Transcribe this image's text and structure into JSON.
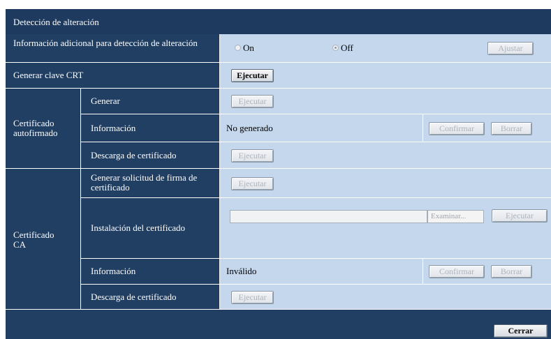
{
  "section_title": "Detección de alteración",
  "tamper": {
    "label": "Información adicional para detección de alteración",
    "on_label": "On",
    "off_label": "Off",
    "selected": "Off",
    "set_button": "Ajustar"
  },
  "crt_key": {
    "label": "Generar clave CRT",
    "execute_button": "Ejecutar"
  },
  "self_signed": {
    "group_label": "Certificado autofirmado",
    "generate_label": "Generar",
    "generate_button": "Ejecutar",
    "info_label": "Información",
    "info_status": "No generado",
    "confirm_button": "Confirmar",
    "delete_button": "Borrar",
    "download_label": "Descarga de certificado",
    "download_button": "Ejecutar"
  },
  "ca": {
    "group_label": "Certificado CA",
    "csr_label": "Generar solicitud de firma de certificado",
    "csr_button": "Ejecutar",
    "install_label": "Instalación del certificado",
    "browse_button": "Examinar...",
    "install_button": "Ejecutar",
    "file_value": "",
    "info_label": "Información",
    "info_status": "Inválido",
    "confirm_button": "Confirmar",
    "delete_button": "Borrar",
    "download_label": "Descarga de certificado",
    "download_button": "Ejecutar"
  },
  "close_button": "Cerrar"
}
